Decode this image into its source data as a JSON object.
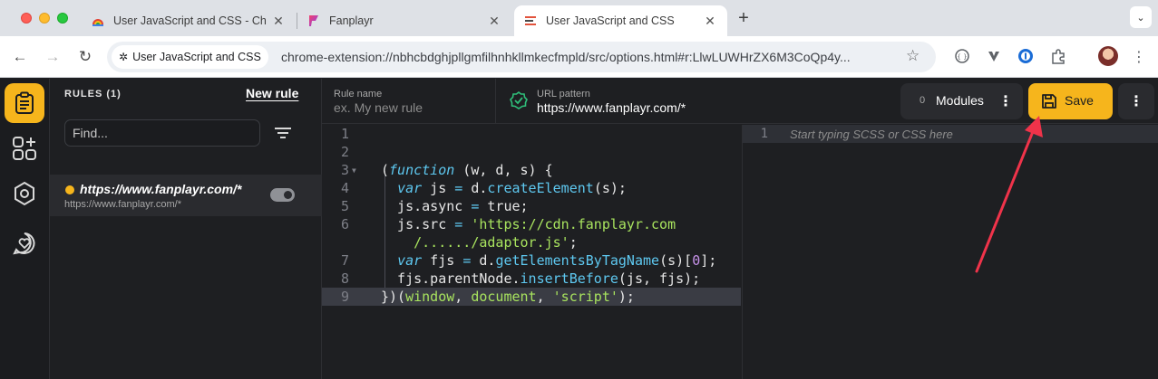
{
  "browser": {
    "tabs": [
      {
        "title": "User JavaScript and CSS - Ch",
        "icon": "chrome-webstore-icon"
      },
      {
        "title": "Fanplayr",
        "icon": "fanplayr-icon"
      },
      {
        "title": "User JavaScript and CSS",
        "icon": "extension-list-icon",
        "active": true
      }
    ],
    "omnibox": {
      "chip": "User JavaScript and CSS",
      "url": "chrome-extension://nbhcbdghjpllgmfilhnhkllmkecfmpld/src/options.html#r:LlwLUWHrZX6M3CoQp4y..."
    }
  },
  "rail": {
    "items": [
      "rules-icon",
      "modules-icon",
      "settings-icon",
      "heart-chat-icon"
    ]
  },
  "sidebar": {
    "title": "RULES (1)",
    "new_rule": "New rule",
    "find_placeholder": "Find...",
    "rules": [
      {
        "name": "https://www.fanplayr.com/*",
        "url": "https://www.fanplayr.com/*",
        "enabled": true
      }
    ]
  },
  "header": {
    "rule_name_label": "Rule name",
    "rule_name_placeholder": "ex. My new rule",
    "url_pattern_label": "URL pattern",
    "url_pattern_value": "https://www.fanplayr.com/*",
    "modules_count": "0",
    "modules_label": "Modules",
    "save_label": "Save"
  },
  "js_editor": {
    "lines": [
      {
        "n": "1",
        "text": ""
      },
      {
        "n": "2",
        "text": ""
      },
      {
        "n": "3",
        "text": "(function (w, d, s) {"
      },
      {
        "n": "4",
        "text": "  var js = d.createElement(s);"
      },
      {
        "n": "5",
        "text": "  js.async = true;"
      },
      {
        "n": "6",
        "text": "  js.src = 'https://cdn.fanplayr.com"
      },
      {
        "n": "",
        "text": "    /....../adaptor.js';"
      },
      {
        "n": "7",
        "text": "  var fjs = d.getElementsByTagName(s)[0];"
      },
      {
        "n": "8",
        "text": "  fjs.parentNode.insertBefore(js, fjs);"
      },
      {
        "n": "9",
        "text": "})(window, document, 'script');"
      }
    ]
  },
  "css_editor": {
    "line_number": "1",
    "placeholder": "Start typing SCSS or CSS here"
  },
  "colors": {
    "accent": "#f6b51c",
    "annotation_arrow": "#f0334a"
  }
}
